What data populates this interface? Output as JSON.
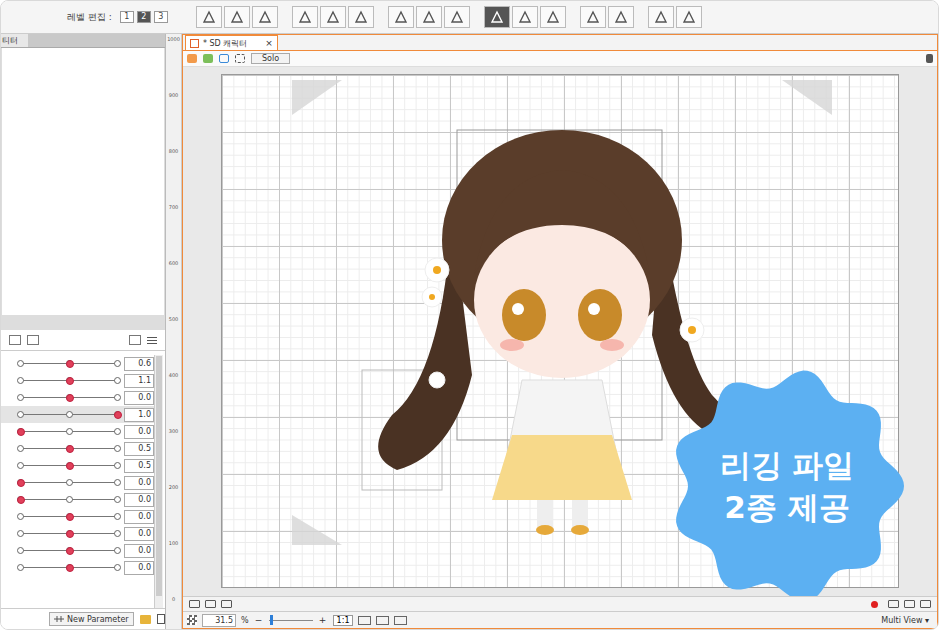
{
  "toolbar": {
    "label": "레벨 편집 :",
    "levels": [
      {
        "label": "1",
        "selected": false
      },
      {
        "label": "2",
        "selected": true
      },
      {
        "label": "3",
        "selected": false
      }
    ]
  },
  "left_panel": {
    "tab": "티터"
  },
  "parameters": [
    {
      "value": "0.6",
      "level": 0.5,
      "selected": false
    },
    {
      "value": "1.1",
      "level": 0.5,
      "selected": false
    },
    {
      "value": "0.0",
      "level": 0.5,
      "selected": false
    },
    {
      "value": "1.0",
      "level": 1,
      "selected": true
    },
    {
      "value": "0.0",
      "level": 0,
      "selected": false
    },
    {
      "value": "0.5",
      "level": 0.5,
      "selected": false
    },
    {
      "value": "0.5",
      "level": 0.5,
      "selected": false
    },
    {
      "value": "0.0",
      "level": 0,
      "selected": false
    },
    {
      "value": "0.0",
      "level": 0,
      "selected": false
    },
    {
      "value": "0.0",
      "level": 0.5,
      "selected": false
    },
    {
      "value": "0.0",
      "level": 0.5,
      "selected": false
    },
    {
      "value": "0.0",
      "level": 0.5,
      "selected": false
    },
    {
      "value": "0.0",
      "level": 0.5,
      "selected": false
    }
  ],
  "new_parameter_button": "New Parameter",
  "ruler": [
    "1000",
    "900",
    "800",
    "700",
    "600",
    "500",
    "400",
    "300",
    "200",
    "100",
    "0"
  ],
  "document_tab": {
    "title": "* SD 캐릭터",
    "close": "×"
  },
  "view_toolbar": {
    "solo": "Solo"
  },
  "zoom": {
    "value": "31.5",
    "unit": "%"
  },
  "fit_button": "1:1",
  "view_mode": "Multi View",
  "badge": {
    "lines": [
      "리깅 파일",
      "2종 제공"
    ]
  }
}
